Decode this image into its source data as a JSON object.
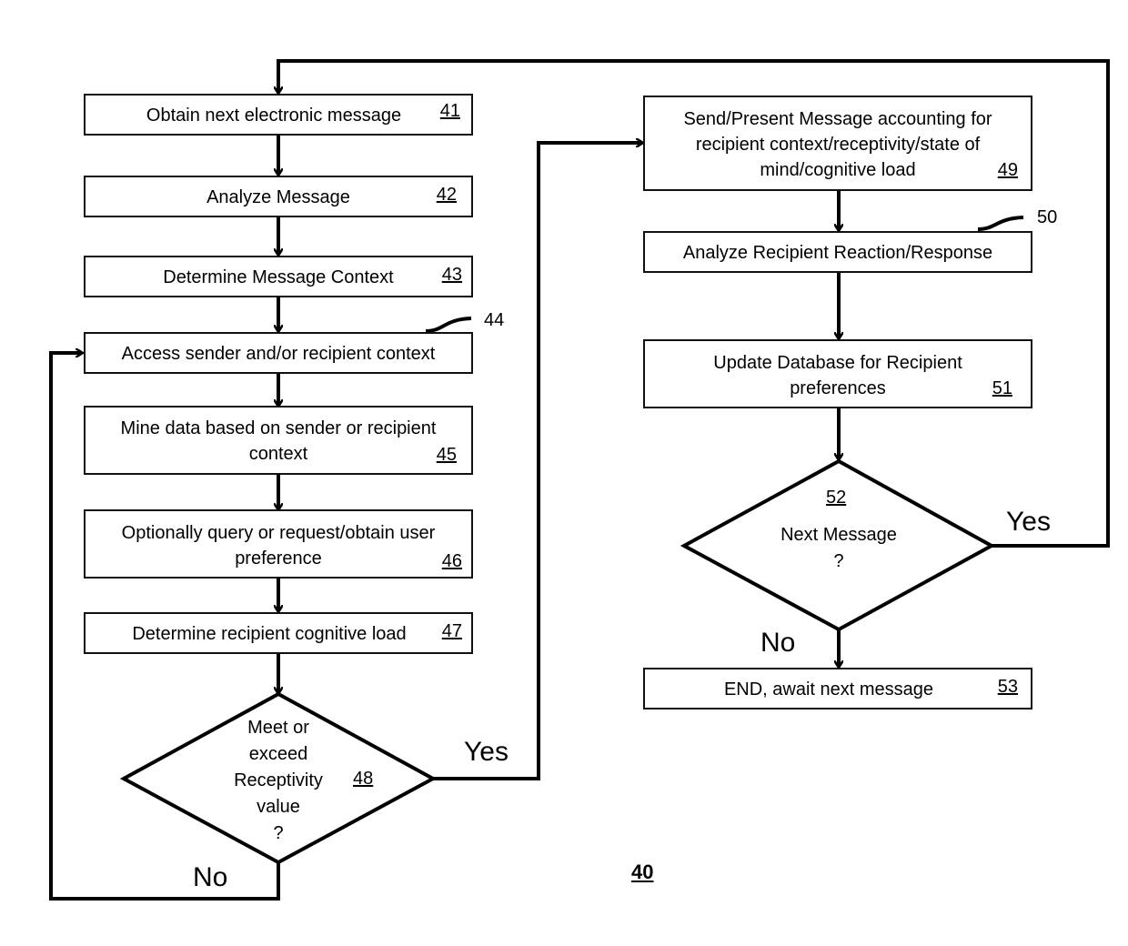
{
  "figure": {
    "number": "40",
    "steps": [
      {
        "id": "41",
        "lines": [
          "Obtain next electronic message"
        ]
      },
      {
        "id": "42",
        "lines": [
          "Analyze Message"
        ]
      },
      {
        "id": "43",
        "lines": [
          "Determine Message Context"
        ]
      },
      {
        "id": "44",
        "lines": [
          "Access sender and/or recipient context"
        ]
      },
      {
        "id": "45",
        "lines": [
          "Mine data based on sender or recipient",
          "context"
        ]
      },
      {
        "id": "46",
        "lines": [
          "Optionally query or request/obtain user",
          "preference"
        ]
      },
      {
        "id": "47",
        "lines": [
          "Determine recipient cognitive load"
        ]
      },
      {
        "id": "49",
        "lines": [
          "Send/Present Message accounting for",
          "recipient context/receptivity/state of",
          "mind/cognitive load"
        ]
      },
      {
        "id": "50",
        "lines": [
          "Analyze Recipient Reaction/Response"
        ]
      },
      {
        "id": "51",
        "lines": [
          "Update Database for Recipient",
          "preferences"
        ]
      },
      {
        "id": "53",
        "lines": [
          "END, await next message"
        ]
      }
    ],
    "decisions": [
      {
        "id": "48",
        "lines": [
          "Meet or",
          "exceed",
          "Receptivity",
          "value",
          "?"
        ],
        "yes_label": "Yes",
        "no_label": "No"
      },
      {
        "id": "52",
        "lines": [
          "Next Message",
          "?"
        ],
        "yes_label": "Yes",
        "no_label": "No"
      }
    ]
  }
}
